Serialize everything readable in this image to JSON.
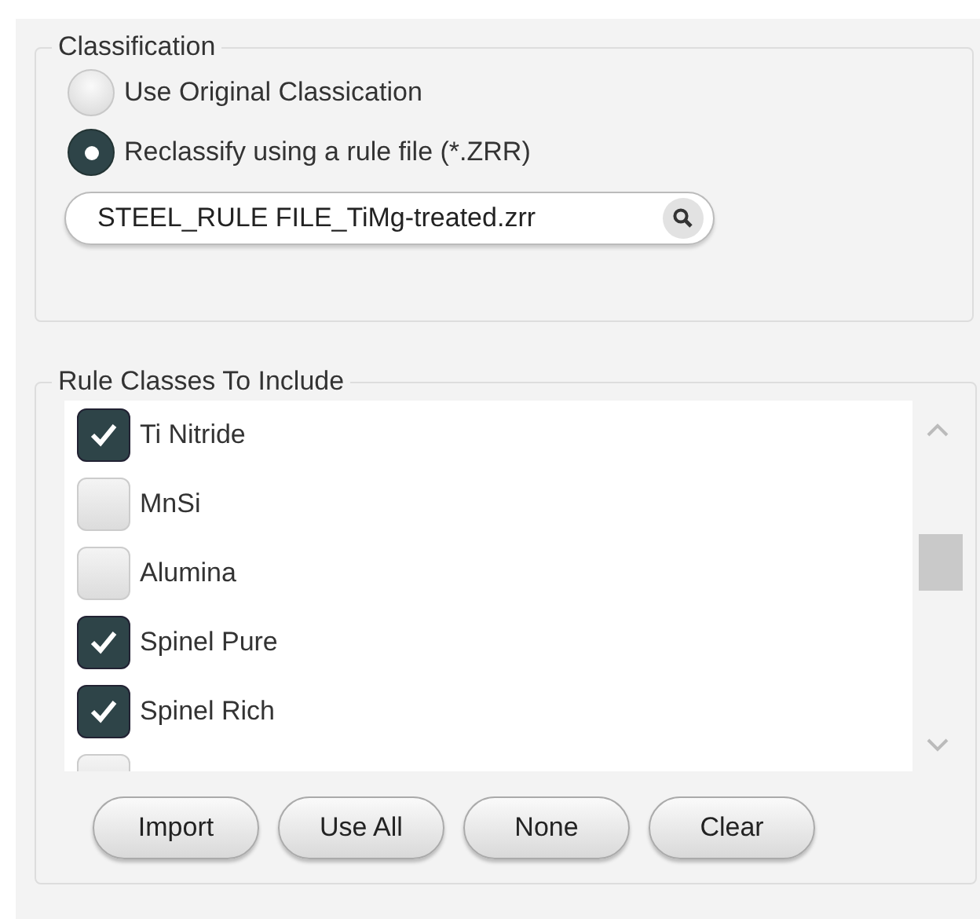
{
  "classification": {
    "title": "Classification",
    "options": [
      {
        "label": "Use Original Classication",
        "selected": false
      },
      {
        "label": "Reclassify using a rule file (*.ZRR)",
        "selected": true
      }
    ],
    "rule_file": {
      "value": "STEEL_RULE FILE_TiMg-treated.zrr"
    }
  },
  "rule_classes": {
    "title": "Rule Classes To Include",
    "items": [
      {
        "label": "Ti Nitride",
        "checked": true
      },
      {
        "label": "MnSi",
        "checked": false
      },
      {
        "label": "Alumina",
        "checked": false
      },
      {
        "label": "Spinel Pure",
        "checked": true
      },
      {
        "label": "Spinel Rich",
        "checked": true
      },
      {
        "checked": false
      }
    ],
    "buttons": [
      "Import",
      "Use All",
      "None",
      "Clear"
    ]
  }
}
